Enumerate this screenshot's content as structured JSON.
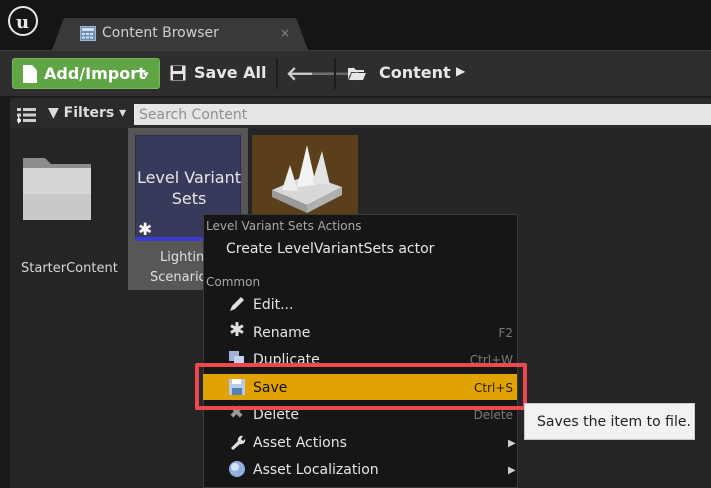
{
  "tab": {
    "title": "Content Browser",
    "close": "×"
  },
  "toolbar": {
    "add_import": "Add/Import",
    "add_caret": "▾",
    "save_all": "Save All",
    "breadcrumb": "Content",
    "breadcrumb_arrow": "▶"
  },
  "filterbar": {
    "filters_label": "Filters",
    "search_placeholder": "Search Content"
  },
  "assets": {
    "starter_label": "StarterContent",
    "lvs_thumb_line1": "Level Variant",
    "lvs_thumb_line2": "Sets",
    "lvs_label_line1": "Lighting",
    "lvs_label_line2": "Scenario"
  },
  "menu": {
    "section1_heading": "Level Variant Sets Actions",
    "create_actor": "Create LevelVariantSets actor",
    "section2_heading": "Common",
    "items": [
      {
        "label": "Edit...",
        "shortcut": "",
        "icon": "pencil-icon"
      },
      {
        "label": "Rename",
        "shortcut": "F2",
        "icon": "asterisk-icon"
      },
      {
        "label": "Duplicate",
        "shortcut": "Ctrl+W",
        "icon": "duplicate-icon"
      },
      {
        "label": "Save",
        "shortcut": "Ctrl+S",
        "icon": "floppy-icon"
      },
      {
        "label": "Delete",
        "shortcut": "Delete",
        "icon": "delete-icon"
      },
      {
        "label": "Asset Actions",
        "shortcut": "",
        "icon": "wrench-icon"
      },
      {
        "label": "Asset Localization",
        "shortcut": "",
        "icon": "globe-icon"
      }
    ]
  },
  "tooltip": {
    "text": "Saves the item to file."
  },
  "colors": {
    "accent_highlight": "#e1a304",
    "callout_red": "#f0484f",
    "add_button_green": "#5fa546"
  }
}
